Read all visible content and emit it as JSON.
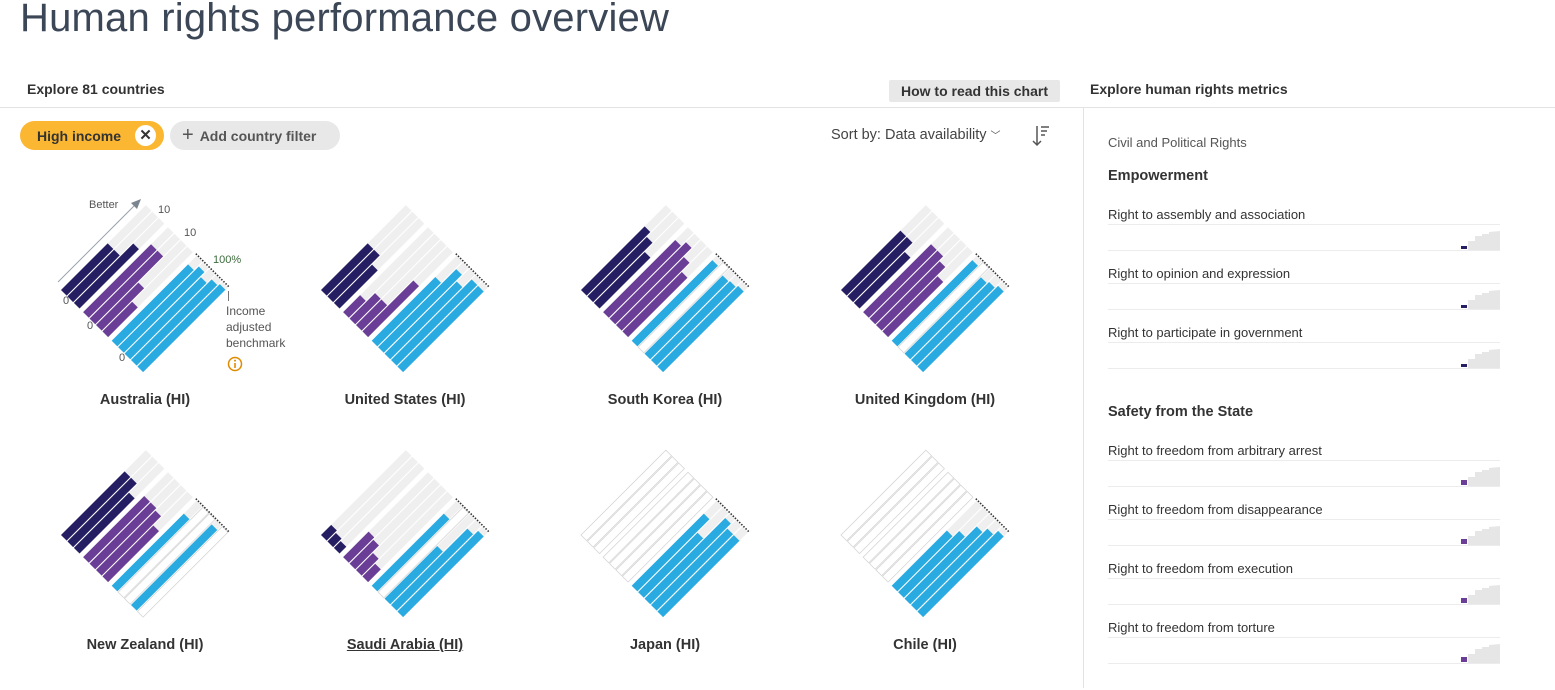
{
  "header": {
    "title": "Human rights performance overview"
  },
  "toolbar": {
    "explore_label": "Explore 81 countries",
    "how_to_read": "How to read this chart",
    "metrics_label": "Explore human rights metrics",
    "filter_chip": "High income",
    "filter_remove_icon": "close-icon",
    "add_filter": "Add country filter",
    "sort_label": "Sort by: Data availability",
    "sort_icon": "sort-descending-icon"
  },
  "colors": {
    "empowerment": "#261e63",
    "safety": "#6a3d96",
    "esr": "#29abe2",
    "background_bar": "#efefef",
    "accent_chip": "#fbb731",
    "info": "#e08a00"
  },
  "legend": {
    "better": "Better",
    "emp_max": "10",
    "safety_max": "10",
    "esr_max": "100%",
    "emp_min": "0",
    "safety_min": "0",
    "esr_min": "0",
    "benchmark": [
      "Income",
      "adjusted",
      "benchmark"
    ],
    "info_icon": "info-icon"
  },
  "countries": [
    {
      "name": "Australia (HI)",
      "empowerment": [
        0.55,
        0.55,
        0.7
      ],
      "safety": [
        0.8,
        0.8,
        0.5,
        0.35
      ],
      "esr": [
        0.9,
        0.95,
        0.9,
        0.95,
        0.97
      ]
    },
    {
      "name": "United States (HI)",
      "empowerment": [
        0.55,
        0.55,
        0.45
      ],
      "safety": [
        0.2,
        0.3,
        0.3,
        0.6
      ],
      "esr": [
        0.75,
        0.92,
        0.85,
        0.95,
        0.95
      ]
    },
    {
      "name": "South Korea (HI)",
      "empowerment": [
        0.75,
        0.7,
        0.6
      ],
      "safety": [
        0.85,
        0.9,
        0.8,
        0.7
      ],
      "esr": [
        0.95,
        null,
        0.92,
        0.93,
        0.95
      ]
    },
    {
      "name": "United Kingdom (HI)",
      "empowerment": [
        0.7,
        0.7,
        0.6
      ],
      "safety": [
        0.8,
        0.8,
        0.75,
        0.65
      ],
      "esr": [
        0.95,
        null,
        0.9,
        0.92,
        0.95
      ]
    },
    {
      "name": "New Zealand (HI)",
      "empowerment": [
        0.75,
        0.75,
        0.65
      ],
      "safety": [
        0.72,
        0.72,
        0.7,
        0.6
      ],
      "esr": [
        0.85,
        null,
        null,
        0.95,
        null
      ]
    },
    {
      "name": "Saudi Arabia (HI)",
      "empowerment": [
        0.12,
        0.1,
        0.08
      ],
      "safety": [
        0.3,
        0.28,
        0.2,
        0.15
      ],
      "esr": [
        0.85,
        null,
        0.62,
        0.9,
        0.95
      ]
    },
    {
      "name": "Japan (HI)",
      "empowerment": [
        null,
        null,
        null
      ],
      "safety": [
        null,
        null,
        null,
        null
      ],
      "esr": [
        0.85,
        0.7,
        0.95,
        0.9,
        0.9
      ]
    },
    {
      "name": "Chile (HI)",
      "empowerment": [
        null,
        null,
        null
      ],
      "safety": [
        null,
        null,
        null,
        null
      ],
      "esr": [
        0.65,
        0.72,
        0.85,
        0.9,
        0.95
      ]
    }
  ],
  "panel": {
    "category": "Civil and Political Rights",
    "sections": [
      {
        "title": "Empowerment",
        "color": "#261e63",
        "metrics": [
          "Right to assembly and association",
          "Right to opinion and expression",
          "Right to participate in government"
        ]
      },
      {
        "title": "Safety from the State",
        "color": "#6a3d96",
        "metrics": [
          "Right to freedom from arbitrary arrest",
          "Right to freedom from disappearance",
          "Right to freedom from execution",
          "Right to freedom from torture"
        ]
      }
    ]
  }
}
